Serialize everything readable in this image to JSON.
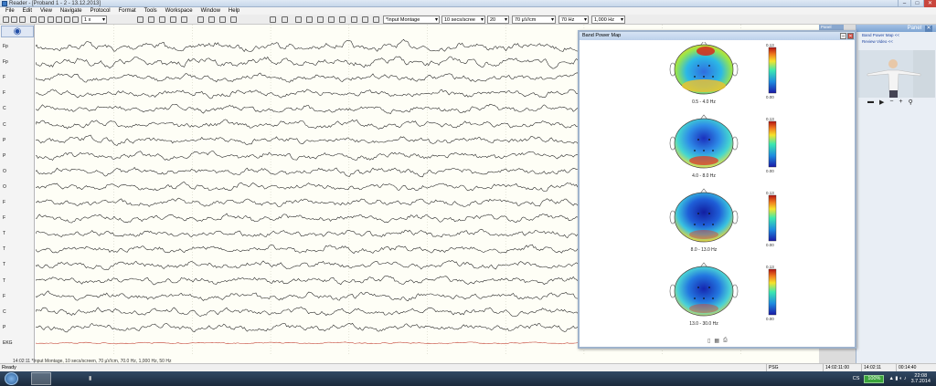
{
  "window": {
    "title": "Reader - [Proband 1 - 2 - 13.12.2013]",
    "min": "–",
    "max": "□",
    "close": "✕"
  },
  "menu": [
    "File",
    "Edit",
    "View",
    "Navigate",
    "Protocol",
    "Format",
    "Tools",
    "Workspace",
    "Window",
    "Help"
  ],
  "toolbar": {
    "speed": "1 x",
    "montage": "*Input Montage",
    "timebase": "10 secs/scree",
    "page": "20",
    "sensitivity": "70 µV/cm",
    "lowfilter": "70 Hz",
    "highfilter": "1,000 Hz"
  },
  "channels": [
    "Fp",
    "Fp",
    "F",
    "F",
    "C",
    "C",
    "P",
    "P",
    "O",
    "O",
    "F",
    "F",
    "T",
    "T",
    "T",
    "T",
    "F",
    "C",
    "P",
    "EKG"
  ],
  "eeg": {
    "footer": "14:02:11 *Input Montage, 10 secs/screen, 70 µV/cm, 70.0 Hz, 1,000 Hz, 50 Hz"
  },
  "popup": {
    "title": "Band Power Map",
    "bands": [
      {
        "label": "0.5 - 4.0 Hz",
        "scale_max": "0.13",
        "scale_min": "0.00"
      },
      {
        "label": "4.0 - 8.0 Hz",
        "scale_max": "0.13",
        "scale_min": "0.00"
      },
      {
        "label": "8.0 - 13.0 Hz",
        "scale_max": "0.13",
        "scale_min": "0.00"
      },
      {
        "label": "13.0 - 30.0 Hz",
        "scale_max": "0.13",
        "scale_min": "0.00"
      }
    ]
  },
  "panel": {
    "title": "Panel",
    "close": "✕",
    "link1": "Band Power Map <<",
    "link2": "Review Video <<",
    "mini": "Panel"
  },
  "statusbar": {
    "ready": "Ready",
    "mode": "PSG",
    "t1": "14:02:11:00",
    "t2": "14:02:11",
    "t3": "00:14:40"
  },
  "taskbar": {
    "lang": "CS",
    "battery": "100%",
    "time": "22:08",
    "date": "3.7.2014"
  },
  "colors": {
    "trace": "#1a1a1a",
    "ekg": "#c0392b",
    "accent": "#7ea4d3"
  }
}
